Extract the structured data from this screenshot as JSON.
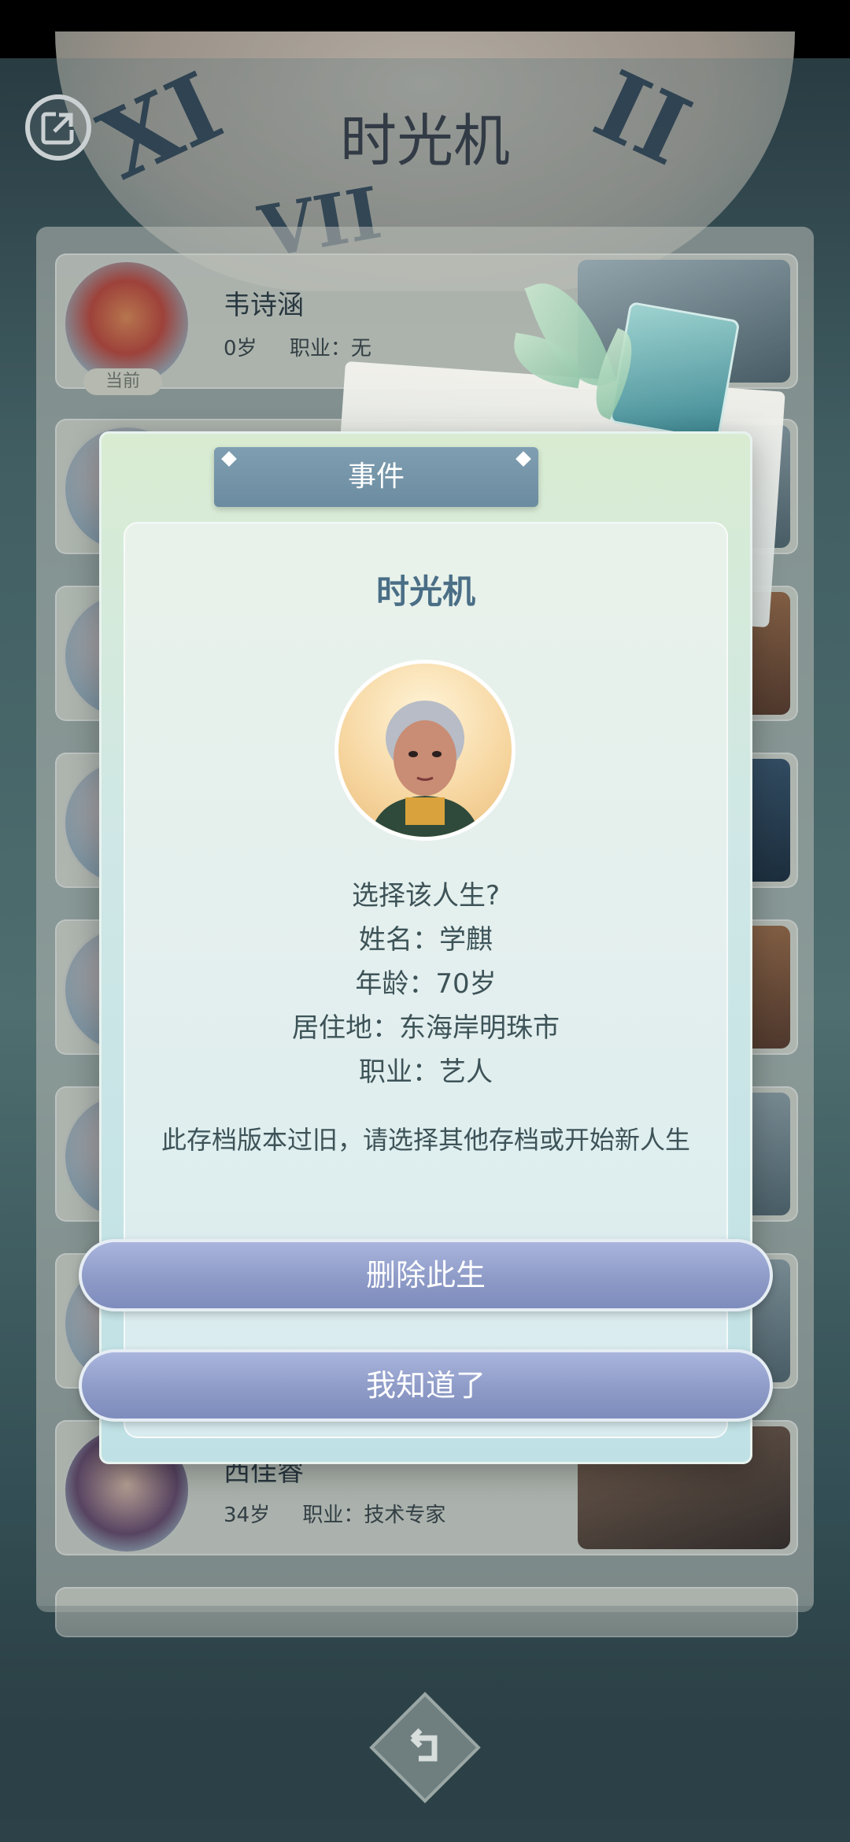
{
  "header": {
    "title": "时光机"
  },
  "save_list": {
    "rows": [
      {
        "name": "韦诗涵",
        "age": "0岁",
        "job": "职业：无",
        "tag": "当前"
      },
      {
        "name": "",
        "age": "",
        "job": "",
        "tag": ""
      },
      {
        "name": "",
        "age": "",
        "job": "",
        "tag": ""
      },
      {
        "name": "",
        "age": "",
        "job": "",
        "tag": ""
      },
      {
        "name": "",
        "age": "",
        "job": "",
        "tag": ""
      },
      {
        "name": "",
        "age": "",
        "job": "",
        "tag": ""
      },
      {
        "name": "",
        "age": "",
        "job": "",
        "tag": ""
      },
      {
        "name": "西佳睿",
        "age": "34岁",
        "job": "职业：技术专家",
        "tag": ""
      }
    ]
  },
  "dialog": {
    "tab_label": "事件",
    "title": "时光机",
    "question": "选择该人生?",
    "name": "姓名：学麒",
    "age": "年龄：70岁",
    "residence": "居住地：东海岸明珠市",
    "job": "职业：艺人",
    "note": "此存档版本过旧，请选择其他存档或开始新人生",
    "delete_button": "删除此生",
    "ok_button": "我知道了"
  },
  "icons": {
    "exit": "exit-share-icon",
    "back": "back-arrow-icon"
  },
  "colors": {
    "dialog_button": "#8e9bc7",
    "tab": "#7f9eb1",
    "title_text": "#4a6e86"
  }
}
